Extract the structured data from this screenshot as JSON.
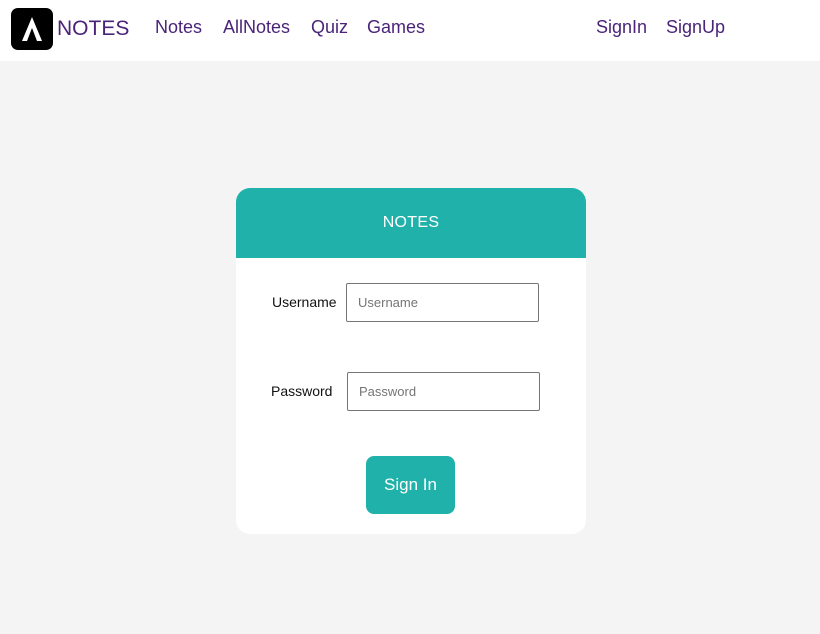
{
  "navbar": {
    "logo_icon": "arrow-a-logo-icon",
    "brand": "NOTES",
    "links": [
      {
        "label": "Notes"
      },
      {
        "label": "AllNotes"
      },
      {
        "label": "Quiz"
      },
      {
        "label": "Games"
      }
    ],
    "auth_links": [
      {
        "label": "SignIn"
      },
      {
        "label": "SignUp"
      }
    ]
  },
  "login_card": {
    "title": "NOTES",
    "username_label": "Username",
    "username_placeholder": "Username",
    "username_value": "",
    "password_label": "Password",
    "password_placeholder": "Password",
    "password_value": "",
    "submit_label": "Sign In"
  },
  "colors": {
    "accent": "#20b2aa",
    "nav_text": "#4a2478",
    "background": "#f4f4f4"
  }
}
